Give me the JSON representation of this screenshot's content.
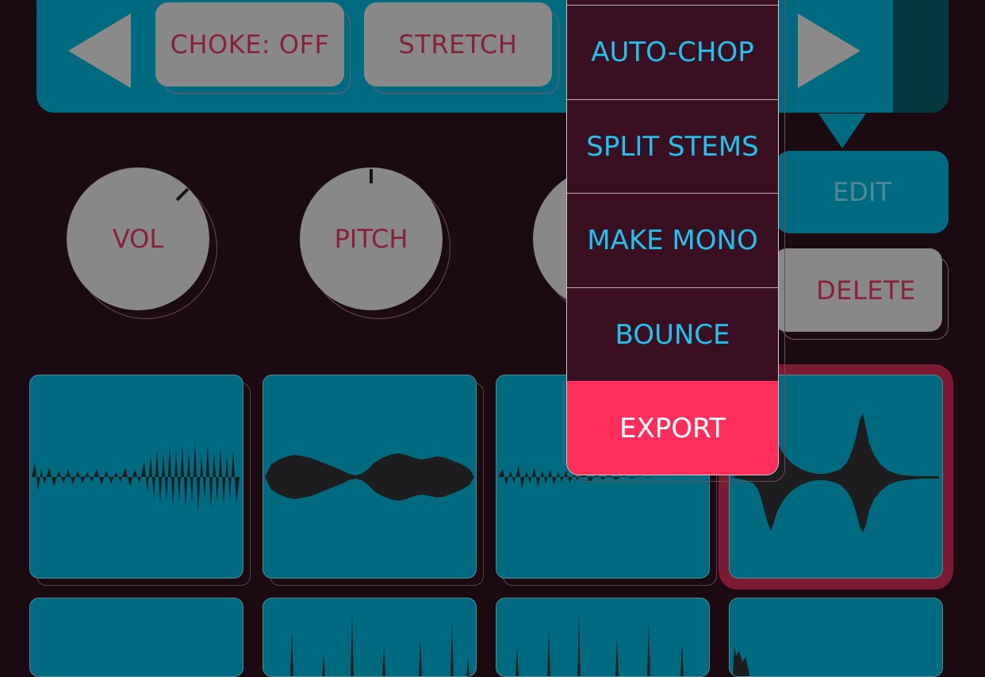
{
  "toolbar": {
    "choke_label": "CHOKE: OFF",
    "stretch_label": "STRETCH"
  },
  "knobs": {
    "vol_label": "VOL",
    "pitch_label": "PITCH"
  },
  "actions": {
    "edit_label": "EDIT",
    "delete_label": "DELETE"
  },
  "menu": {
    "items": [
      {
        "label": "AUTO-CHOP"
      },
      {
        "label": "SPLIT STEMS"
      },
      {
        "label": "MAKE MONO"
      },
      {
        "label": "BOUNCE"
      },
      {
        "label": "EXPORT"
      }
    ]
  },
  "colors": {
    "background": "#1c0a12",
    "panel": "#006a80",
    "button": "#888888",
    "button_text": "#8a1f3a",
    "menu_bg": "#3b0f22",
    "menu_text": "#1fc3ee",
    "export_bg": "#ff2d5a",
    "selected_ring": "#7d1a33"
  },
  "icons": {
    "prev": "triangle-left-icon",
    "next": "triangle-right-icon"
  }
}
